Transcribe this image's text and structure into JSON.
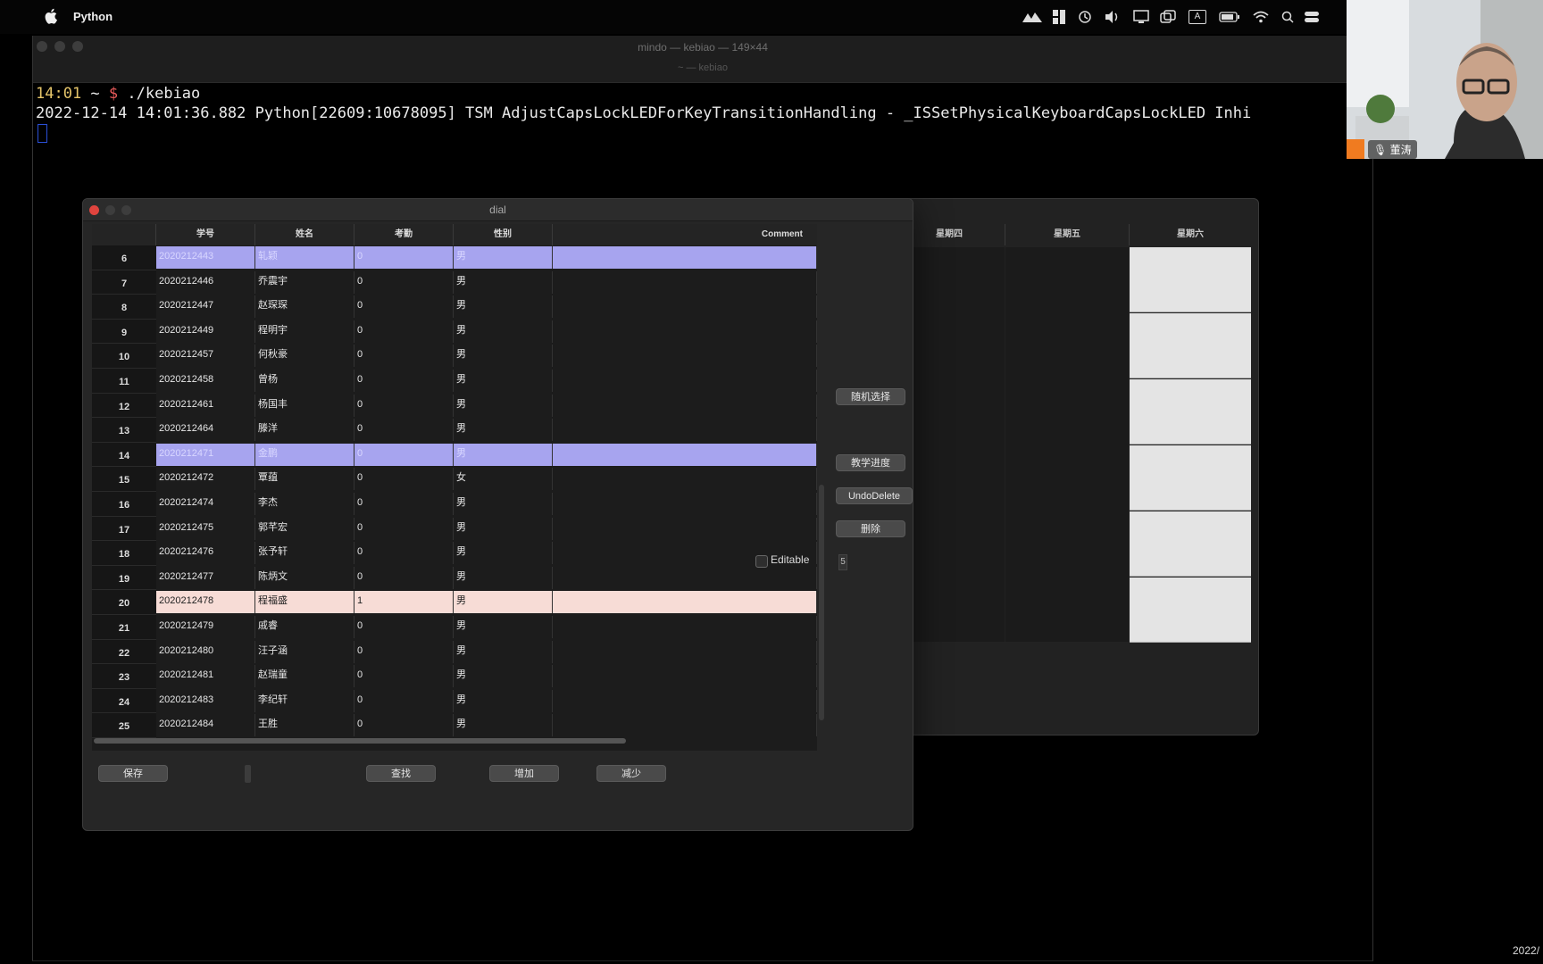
{
  "menubar": {
    "app_name": "Python",
    "tray_input_label": "A"
  },
  "terminal": {
    "title": "mindo — kebiao — 149×44",
    "subtitle": "~ — kebiao",
    "prompt_time": "14:01",
    "prompt_path": " ~ ",
    "prompt_symbol": "$",
    "command": " ./kebiao",
    "log_line": "2022-12-14 14:01:36.882 Python[22609:10678095] TSM AdjustCapsLockLEDForKeyTransitionHandling - _ISSetPhysicalKeyboardCapsLockLED Inhi"
  },
  "dial": {
    "title": "dial",
    "columns": [
      "学号",
      "姓名",
      "考勤",
      "性别",
      "Comment"
    ],
    "rows": [
      {
        "num": "6",
        "id": "2020212443",
        "name": "轧颖",
        "att": "0",
        "sex": "男",
        "comment": "",
        "state": "sel"
      },
      {
        "num": "7",
        "id": "2020212446",
        "name": "乔震宇",
        "att": "0",
        "sex": "男",
        "comment": "",
        "state": ""
      },
      {
        "num": "8",
        "id": "2020212447",
        "name": "赵琛琛",
        "att": "0",
        "sex": "男",
        "comment": "",
        "state": ""
      },
      {
        "num": "9",
        "id": "2020212449",
        "name": "程明宇",
        "att": "0",
        "sex": "男",
        "comment": "",
        "state": ""
      },
      {
        "num": "10",
        "id": "2020212457",
        "name": "何秋豪",
        "att": "0",
        "sex": "男",
        "comment": "",
        "state": ""
      },
      {
        "num": "11",
        "id": "2020212458",
        "name": "曾杨",
        "att": "0",
        "sex": "男",
        "comment": "",
        "state": ""
      },
      {
        "num": "12",
        "id": "2020212461",
        "name": "杨国丰",
        "att": "0",
        "sex": "男",
        "comment": "",
        "state": ""
      },
      {
        "num": "13",
        "id": "2020212464",
        "name": "滕洋",
        "att": "0",
        "sex": "男",
        "comment": "",
        "state": ""
      },
      {
        "num": "14",
        "id": "2020212471",
        "name": "金鹏",
        "att": "0",
        "sex": "男",
        "comment": "",
        "state": "sel"
      },
      {
        "num": "15",
        "id": "2020212472",
        "name": "覃蕴",
        "att": "0",
        "sex": "女",
        "comment": "",
        "state": ""
      },
      {
        "num": "16",
        "id": "2020212474",
        "name": "李杰",
        "att": "0",
        "sex": "男",
        "comment": "",
        "state": ""
      },
      {
        "num": "17",
        "id": "2020212475",
        "name": "郭芊宏",
        "att": "0",
        "sex": "男",
        "comment": "",
        "state": ""
      },
      {
        "num": "18",
        "id": "2020212476",
        "name": "张予轩",
        "att": "0",
        "sex": "男",
        "comment": "",
        "state": ""
      },
      {
        "num": "19",
        "id": "2020212477",
        "name": "陈炳文",
        "att": "0",
        "sex": "男",
        "comment": "",
        "state": ""
      },
      {
        "num": "20",
        "id": "2020212478",
        "name": "程福盛",
        "att": "1",
        "sex": "男",
        "comment": "",
        "state": "hl"
      },
      {
        "num": "21",
        "id": "2020212479",
        "name": "戚睿",
        "att": "0",
        "sex": "男",
        "comment": "",
        "state": ""
      },
      {
        "num": "22",
        "id": "2020212480",
        "name": "汪子涵",
        "att": "0",
        "sex": "男",
        "comment": "",
        "state": ""
      },
      {
        "num": "23",
        "id": "2020212481",
        "name": "赵瑞童",
        "att": "0",
        "sex": "男",
        "comment": "",
        "state": ""
      },
      {
        "num": "24",
        "id": "2020212483",
        "name": "李纪轩",
        "att": "0",
        "sex": "男",
        "comment": "",
        "state": ""
      },
      {
        "num": "25",
        "id": "2020212484",
        "name": "王胜",
        "att": "0",
        "sex": "男",
        "comment": "",
        "state": ""
      }
    ],
    "count_field": "5",
    "random_button": "随机选择",
    "progress_button": "教学进度",
    "undo_button": "UndoDelete",
    "delete_button": "删除",
    "editable_label": "Editable",
    "save_button": "保存",
    "find_button": "查找",
    "add_button": "增加",
    "reduce_button": "减少"
  },
  "schedule": {
    "headers": [
      "星期四",
      "星期五",
      "星期六"
    ]
  },
  "video": {
    "participant_name": "董涛"
  },
  "screen_edge_text": "2022/",
  "colors": {
    "selected_row": "#a7a4ef",
    "highlight_row": "#f7dcd6",
    "close_button": "#e0443e",
    "prompt_time": "#e4c46a",
    "prompt_symbol": "#e85a5a"
  }
}
